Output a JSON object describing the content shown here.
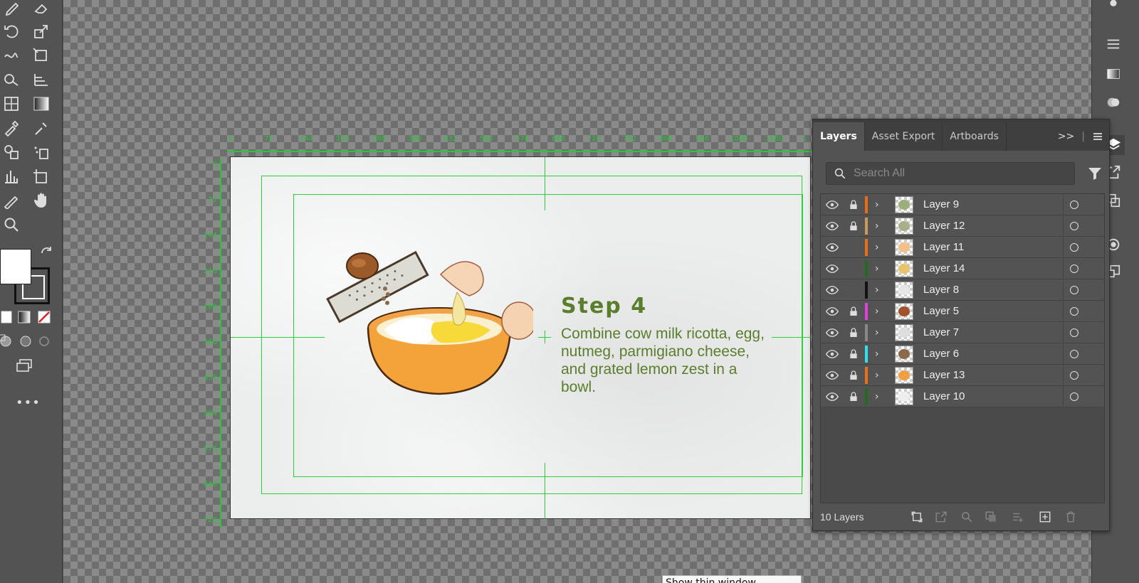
{
  "canvas": {
    "ruler_top_ticks": [
      "0",
      "72",
      "144",
      "216",
      "288",
      "360",
      "432",
      "504",
      "576",
      "648",
      "720",
      "792",
      "864",
      "936",
      "1008",
      "1080",
      "1"
    ],
    "ruler_left_ticks": [
      "0",
      "72",
      "144",
      "216",
      "288",
      "360",
      "432",
      "504",
      "576",
      "648",
      "720"
    ],
    "artboard": {
      "title": "Step 4",
      "description": "Combine cow milk ricotta, egg, nutmeg, parmigiano cheese, and grated lemon zest in a bowl."
    },
    "tooltip": "Show thin window"
  },
  "layers_panel": {
    "tabs": [
      {
        "label": "Layers",
        "active": true
      },
      {
        "label": "Asset Export",
        "active": false
      },
      {
        "label": "Artboards",
        "active": false
      }
    ],
    "overflow_label": ">>",
    "search_placeholder": "Search All",
    "layers": [
      {
        "name": "Layer 9",
        "locked": true,
        "color": "#e86a1a",
        "thumb": "#9ab07a"
      },
      {
        "name": "Layer 12",
        "locked": true,
        "color": "#c99a5a",
        "thumb": "#a7b089"
      },
      {
        "name": "Layer 11",
        "locked": false,
        "color": "#e8701a",
        "thumb": "#f3c08a"
      },
      {
        "name": "Layer 14",
        "locked": false,
        "color": "#1f6d1f",
        "thumb": "#e9c36a"
      },
      {
        "name": "Layer 8",
        "locked": false,
        "color": "#111111",
        "thumb": "#e6e6e6"
      },
      {
        "name": "Layer 5",
        "locked": true,
        "color": "#e040e0",
        "thumb": "#a0522d"
      },
      {
        "name": "Layer 7",
        "locked": true,
        "color": "#888888",
        "thumb": "#dedede"
      },
      {
        "name": "Layer 6",
        "locked": true,
        "color": "#30e0f0",
        "thumb": "#8a6a4a"
      },
      {
        "name": "Layer 13",
        "locked": true,
        "color": "#e8701a",
        "thumb": "#f0a040"
      },
      {
        "name": "Layer 10",
        "locked": true,
        "color": "#1f6d1f",
        "thumb": "#eeeeee"
      }
    ],
    "count_label": "10 Layers"
  },
  "colors": {
    "guide": "#2bd13d",
    "title_green": "#5a7e2c"
  }
}
